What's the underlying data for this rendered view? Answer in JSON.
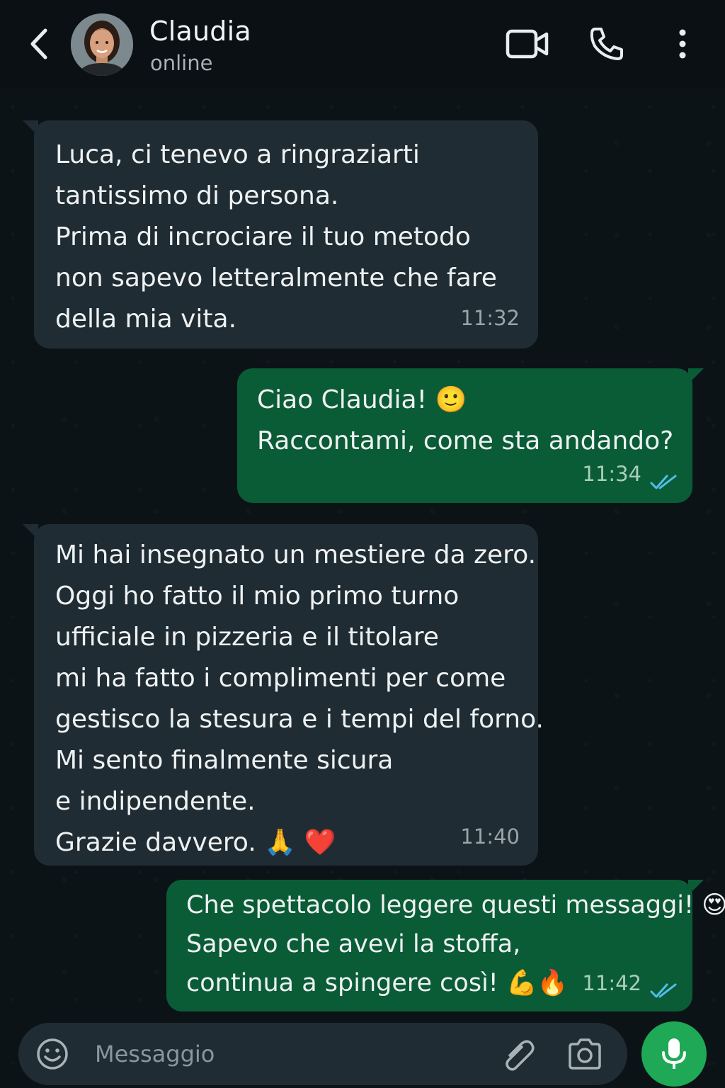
{
  "header": {
    "contact_name": "Claudia",
    "status": "online",
    "icons": [
      "back-arrow-icon",
      "video-call-icon",
      "phone-icon",
      "more-vert-icon"
    ]
  },
  "messages": [
    {
      "direction": "incoming",
      "lines": [
        "Luca, ci tenevo a ringraziarti",
        "tantissimo di persona.",
        "Prima di incrociare il tuo metodo",
        "non sapevo letteralmente che fare",
        "della mia vita."
      ],
      "time": "11:32"
    },
    {
      "direction": "outgoing",
      "lines": [
        "Ciao Claudia! 🙂",
        "Raccontami, come sta andando?"
      ],
      "time": "11:34",
      "read": true
    },
    {
      "direction": "incoming",
      "lines": [
        "Mi hai insegnato un mestiere da zero.",
        "Oggi ho fatto il mio primo turno",
        "ufficiale in pizzeria e il titolare",
        "mi ha fatto i complimenti per come",
        "gestisco la stesura e i tempi del forno.",
        "Mi sento finalmente sicura",
        "e indipendente.",
        "Grazie davvero. 🙏 ❤️"
      ],
      "time": "11:40"
    },
    {
      "direction": "outgoing",
      "lines": [
        "Che spettacolo leggere questi messaggi! 😍",
        "Sapevo che avevi la stoffa,",
        "continua a spingere così! 💪🔥"
      ],
      "time": "11:42",
      "read": true
    }
  ],
  "input": {
    "placeholder": "Messaggio",
    "icons": [
      "emoji-icon",
      "attach-icon",
      "camera-icon",
      "mic-icon"
    ]
  },
  "colors": {
    "background": "#0b1014",
    "incoming_bubble": "#202c33",
    "outgoing_bubble": "#0a5c36",
    "read_ticks": "#53bdeb",
    "mic_button": "#1fa855"
  }
}
